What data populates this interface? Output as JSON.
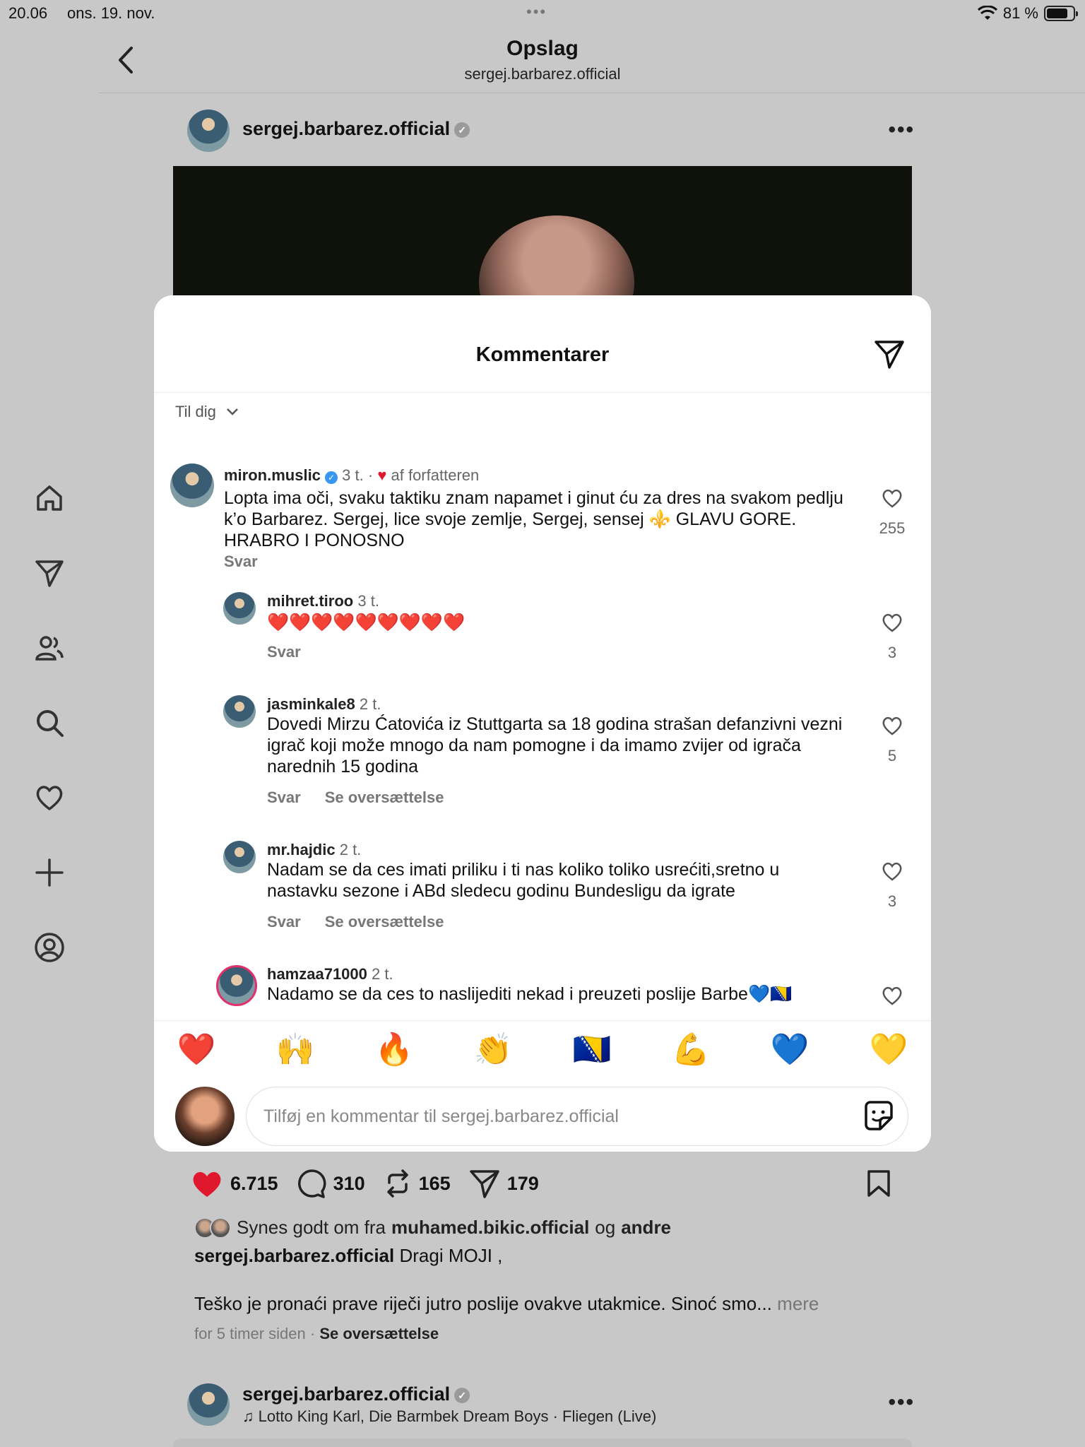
{
  "status_bar": {
    "time": "20.06",
    "date": "ons. 19. nov.",
    "battery": "81 %",
    "battery_level": 0.81
  },
  "header": {
    "title": "Opslag",
    "subtitle": "sergej.barbarez.official"
  },
  "post": {
    "username": "sergej.barbarez.official"
  },
  "modal": {
    "title": "Kommentarer",
    "sort_label": "Til dig",
    "comments": [
      {
        "username": "miron.muslic",
        "time": "3 t.",
        "liked_by_author": "af forfatteren",
        "text": "Lopta ima oči, svaku taktiku znam napamet i ginut ću za dres na svakom pedlju k’o Barbarez. Sergej, lice svoje zemlje, Sergej, sensej ⚜️ GLAVU GORE. HRABRO I PONOSNO",
        "reply": "Svar",
        "likes": "255"
      },
      {
        "username": "mihret.tiroo",
        "time": "3 t.",
        "text": "❤️❤️❤️❤️❤️❤️❤️❤️❤️",
        "reply": "Svar",
        "likes": "3"
      },
      {
        "username": "jasminkale8",
        "time": "2 t.",
        "text": "Dovedi Mirzu Ćatovića iz Stuttgarta sa 18 godina strašan defanzivni vezni igrač koji može mnogo da nam pomogne i da imamo zvijer od igrača narednih 15 godina",
        "reply": "Svar",
        "translate": "Se oversættelse",
        "likes": "5"
      },
      {
        "username": "mr.hajdic",
        "time": "2 t.",
        "text": "Nadam se da ces imati priliku i ti nas koliko toliko usrećiti,sretno u nastavku sezone i ABd sledecu godinu Bundesligu da igrate",
        "reply": "Svar",
        "translate": "Se oversættelse",
        "likes": "3"
      },
      {
        "username": "hamzaa71000",
        "time": "2 t.",
        "text": "Nadamo se da ces to naslijediti nekad i preuzeti poslije Barbe💙🇧🇦"
      }
    ],
    "emoji_reactions": [
      "❤️",
      "🙌",
      "🔥",
      "👏",
      "🇧🇦",
      "💪",
      "💙",
      "💛"
    ],
    "input_placeholder": "Tilføj en kommentar til sergej.barbarez.official"
  },
  "stats": {
    "likes": "6.715",
    "comments": "310",
    "reposts": "165",
    "shares": "179"
  },
  "likers": {
    "prefix": "Synes godt om fra",
    "user1": "muhamed.bikic.official",
    "conj": "og",
    "user2": "andre"
  },
  "caption": {
    "username": "sergej.barbarez.official",
    "text": "Dragi MOJI ,",
    "line2": "Teško je pronaći prave riječi jutro poslije ovakve utakmice. Sinoć smo...",
    "more": "mere"
  },
  "posted": {
    "time": "for 5 timer siden",
    "separator": "·",
    "translate": "Se oversættelse"
  },
  "next_post": {
    "username": "sergej.barbarez.official",
    "music": "Lotto King Karl, Die Barmbek Dream Boys · Fliegen (Live)"
  }
}
